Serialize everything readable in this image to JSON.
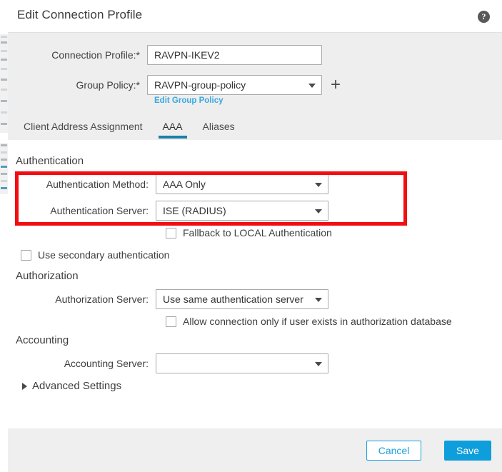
{
  "dialog": {
    "title": "Edit Connection Profile",
    "help_icon": "help-icon",
    "help_glyph": "?"
  },
  "top_form": {
    "connection_profile": {
      "label": "Connection Profile:*",
      "value": "RAVPN-IKEV2",
      "placeholder": ""
    },
    "group_policy": {
      "label": "Group Policy:*",
      "value": "RAVPN-group-policy",
      "add_icon_glyph": "+",
      "edit_link": "Edit Group Policy"
    }
  },
  "tabs": [
    {
      "label": "Client Address Assignment",
      "active": false
    },
    {
      "label": "AAA",
      "active": true
    },
    {
      "label": "Aliases",
      "active": false
    }
  ],
  "authentication": {
    "section_title": "Authentication",
    "method": {
      "label": "Authentication Method:",
      "value": "AAA Only"
    },
    "server": {
      "label": "Authentication Server:",
      "value": "ISE (RADIUS)"
    },
    "fallback_checkbox": {
      "label": "Fallback to LOCAL Authentication",
      "checked": false
    },
    "secondary_checkbox": {
      "label": "Use secondary authentication",
      "checked": false
    }
  },
  "authorization": {
    "section_title": "Authorization",
    "server": {
      "label": "Authorization Server:",
      "value": "Use same authentication server"
    },
    "allow_checkbox": {
      "label": "Allow connection only if user exists in authorization database",
      "checked": false
    }
  },
  "accounting": {
    "section_title": "Accounting",
    "server": {
      "label": "Accounting Server:",
      "value": ""
    }
  },
  "advanced": {
    "label": "Advanced Settings",
    "expanded": false
  },
  "footer": {
    "cancel_label": "Cancel",
    "save_label": "Save"
  },
  "colors": {
    "accent_blue": "#0d9edb",
    "link_blue": "#3aa8e0",
    "tab_underline": "#1b7fa8",
    "highlight_red": "#f20d12",
    "panel_bg": "#eeeeee",
    "content_bg": "#ffffff"
  }
}
